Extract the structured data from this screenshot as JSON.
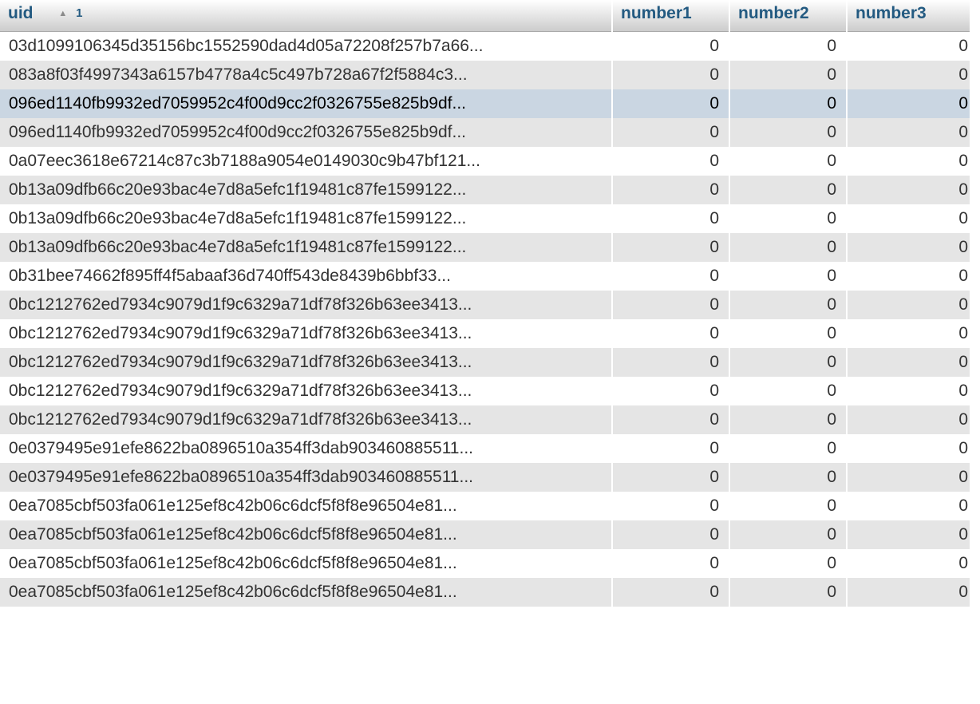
{
  "table": {
    "columns": [
      {
        "label": "uid",
        "sort_order": "1"
      },
      {
        "label": "number1"
      },
      {
        "label": "number2"
      },
      {
        "label": "number3"
      }
    ],
    "rows": [
      {
        "uid": "03d1099106345d35156bc1552590dad4d05a72208f257b7a66...",
        "number1": "0",
        "number2": "0",
        "number3": "0"
      },
      {
        "uid": "083a8f03f4997343a6157b4778a4c5c497b728a67f2f5884c3...",
        "number1": "0",
        "number2": "0",
        "number3": "0"
      },
      {
        "uid": "096ed1140fb9932ed7059952c4f00d9cc2f0326755e825b9df...",
        "number1": "0",
        "number2": "0",
        "number3": "0",
        "marked": true
      },
      {
        "uid": "096ed1140fb9932ed7059952c4f00d9cc2f0326755e825b9df...",
        "number1": "0",
        "number2": "0",
        "number3": "0"
      },
      {
        "uid": "0a07eec3618e67214c87c3b7188a9054e0149030c9b47bf121...",
        "number1": "0",
        "number2": "0",
        "number3": "0"
      },
      {
        "uid": "0b13a09dfb66c20e93bac4e7d8a5efc1f19481c87fe1599122...",
        "number1": "0",
        "number2": "0",
        "number3": "0"
      },
      {
        "uid": "0b13a09dfb66c20e93bac4e7d8a5efc1f19481c87fe1599122...",
        "number1": "0",
        "number2": "0",
        "number3": "0"
      },
      {
        "uid": "0b13a09dfb66c20e93bac4e7d8a5efc1f19481c87fe1599122...",
        "number1": "0",
        "number2": "0",
        "number3": "0"
      },
      {
        "uid": "0b31bee74662f895ff4f5abaaf36d740ff543de8439b6bbf33...",
        "number1": "0",
        "number2": "0",
        "number3": "0"
      },
      {
        "uid": "0bc1212762ed7934c9079d1f9c6329a71df78f326b63ee3413...",
        "number1": "0",
        "number2": "0",
        "number3": "0"
      },
      {
        "uid": "0bc1212762ed7934c9079d1f9c6329a71df78f326b63ee3413...",
        "number1": "0",
        "number2": "0",
        "number3": "0"
      },
      {
        "uid": "0bc1212762ed7934c9079d1f9c6329a71df78f326b63ee3413...",
        "number1": "0",
        "number2": "0",
        "number3": "0"
      },
      {
        "uid": "0bc1212762ed7934c9079d1f9c6329a71df78f326b63ee3413...",
        "number1": "0",
        "number2": "0",
        "number3": "0"
      },
      {
        "uid": "0bc1212762ed7934c9079d1f9c6329a71df78f326b63ee3413...",
        "number1": "0",
        "number2": "0",
        "number3": "0"
      },
      {
        "uid": "0e0379495e91efe8622ba0896510a354ff3dab903460885511...",
        "number1": "0",
        "number2": "0",
        "number3": "0"
      },
      {
        "uid": "0e0379495e91efe8622ba0896510a354ff3dab903460885511...",
        "number1": "0",
        "number2": "0",
        "number3": "0"
      },
      {
        "uid": "0ea7085cbf503fa061e125ef8c42b06c6dcf5f8f8e96504e81...",
        "number1": "0",
        "number2": "0",
        "number3": "0"
      },
      {
        "uid": "0ea7085cbf503fa061e125ef8c42b06c6dcf5f8f8e96504e81...",
        "number1": "0",
        "number2": "0",
        "number3": "0"
      },
      {
        "uid": "0ea7085cbf503fa061e125ef8c42b06c6dcf5f8f8e96504e81...",
        "number1": "0",
        "number2": "0",
        "number3": "0"
      },
      {
        "uid": "0ea7085cbf503fa061e125ef8c42b06c6dcf5f8f8e96504e81...",
        "number1": "0",
        "number2": "0",
        "number3": "0"
      }
    ]
  },
  "icons": {
    "sort": "sort-ascending-icon"
  },
  "colors": {
    "header_text": "#235a81",
    "row_even": "#e5e5e5",
    "row_marked": "#cad6e2"
  }
}
